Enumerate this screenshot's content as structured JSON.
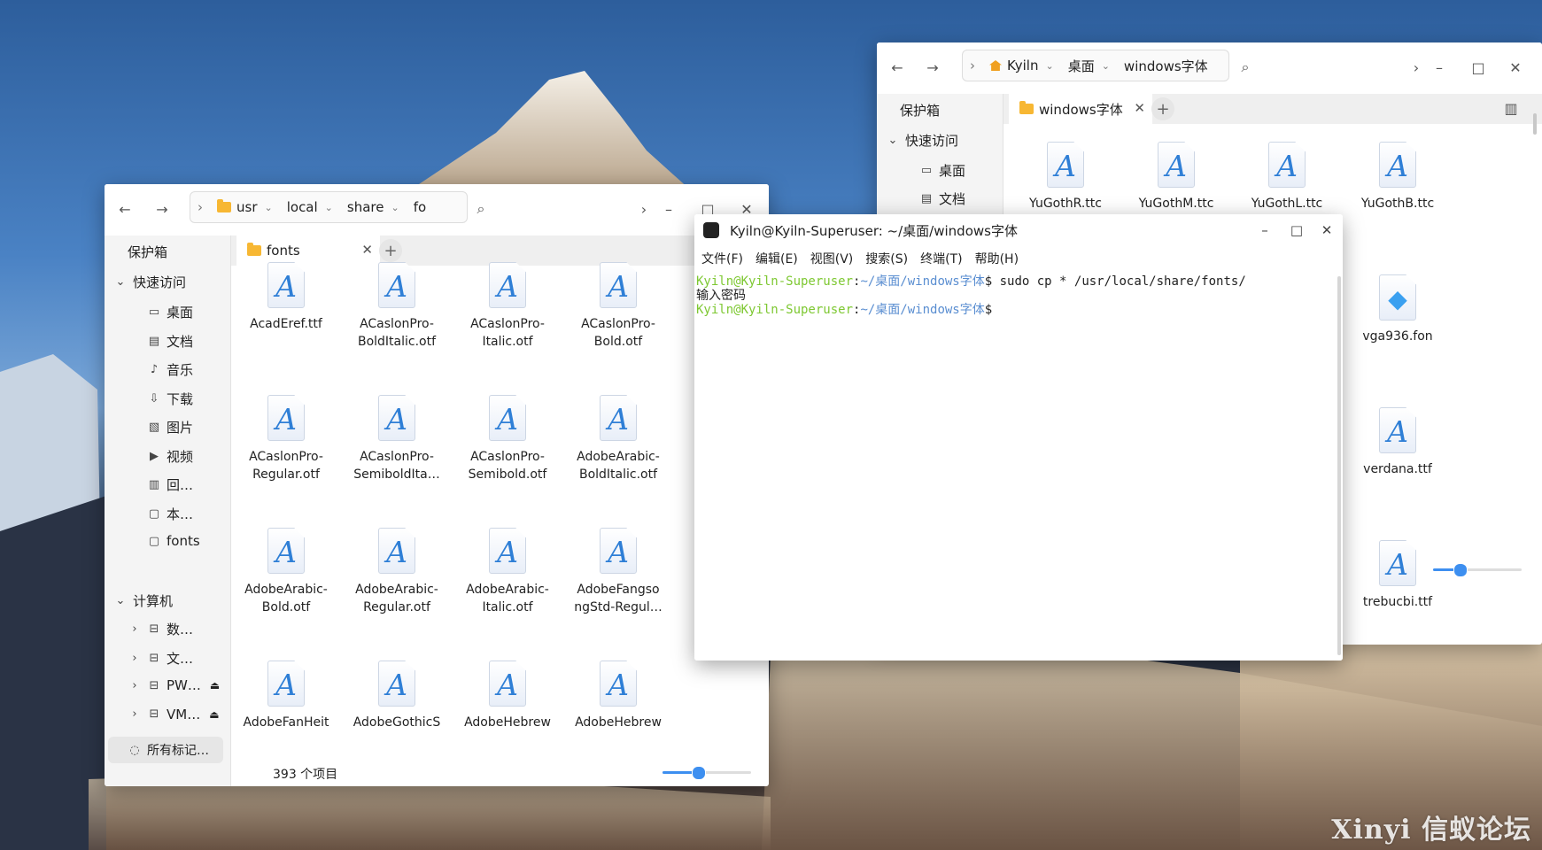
{
  "fm_left": {
    "crumbs": [
      "usr",
      "local",
      "share",
      "fo"
    ],
    "tab_label": "fonts",
    "sidebar": {
      "vault": "保护箱",
      "quick_access": "快速访问",
      "items": [
        {
          "label": "桌面",
          "icon": "desktop-icon",
          "glyph": "▭"
        },
        {
          "label": "文档",
          "icon": "document-icon",
          "glyph": "▤"
        },
        {
          "label": "音乐",
          "icon": "music-icon",
          "glyph": "♪"
        },
        {
          "label": "下载",
          "icon": "download-icon",
          "glyph": "⇩"
        },
        {
          "label": "图片",
          "icon": "image-icon",
          "glyph": "▧"
        },
        {
          "label": "视频",
          "icon": "video-icon",
          "glyph": "▶"
        },
        {
          "label": "回…",
          "icon": "trash-icon",
          "glyph": "▥"
        },
        {
          "label": "本…",
          "icon": "folder-icon",
          "glyph": "▢"
        },
        {
          "label": "fonts",
          "icon": "folder-icon",
          "glyph": "▢"
        }
      ],
      "computer": "计算机",
      "drives": [
        {
          "label": "数…",
          "icon": "drive-icon",
          "eject": false
        },
        {
          "label": "文…",
          "icon": "drive-icon",
          "eject": false
        },
        {
          "label": "PW…",
          "icon": "usb-drive-icon",
          "eject": true
        },
        {
          "label": "VM…",
          "icon": "disc-drive-icon",
          "eject": true
        }
      ],
      "all_tags": "所有标记…"
    },
    "files": [
      [
        "AcadEref.ttf"
      ],
      [
        "ACaslonPro-",
        "BoldItalic.otf"
      ],
      [
        "ACaslonPro-",
        "Italic.otf"
      ],
      [
        "ACaslonPro-",
        "Bold.otf"
      ],
      [
        "ACaslonPro-",
        "Regular.otf"
      ],
      [
        "ACaslonPro-",
        "SemiboldIta…"
      ],
      [
        "ACaslonPro-",
        "Semibold.otf"
      ],
      [
        "AdobeArabic-",
        "BoldItalic.otf"
      ],
      [
        "AdobeArabic-",
        "Bold.otf"
      ],
      [
        "AdobeArabic-",
        "Regular.otf"
      ],
      [
        "AdobeArabic-",
        "Italic.otf"
      ],
      [
        "AdobeFangso",
        "ngStd-Regul…"
      ],
      [
        "AdobeFanHeit"
      ],
      [
        "AdobeGothicS"
      ],
      [
        "AdobeHebrew"
      ],
      [
        "AdobeHebrew"
      ]
    ],
    "status": "393 个项目",
    "zoom_level": 0.4
  },
  "fm_right": {
    "crumbs": [
      "Kyiln",
      "桌面",
      "windows字体"
    ],
    "tab_label": "windows字体",
    "sidebar": {
      "vault": "保护箱",
      "quick_access": "快速访问",
      "items": [
        {
          "label": "桌面",
          "icon": "desktop-icon",
          "glyph": "▭"
        },
        {
          "label": "文档",
          "icon": "document-icon",
          "glyph": "▤"
        }
      ]
    },
    "files": [
      {
        "name": "YuGothR.ttc",
        "type": "font"
      },
      {
        "name": "YuGothM.ttc",
        "type": "font"
      },
      {
        "name": "YuGothL.ttc",
        "type": "font"
      },
      {
        "name": "YuGothB.ttc",
        "type": "font"
      },
      {
        "name": "vga936.fon",
        "type": "fon"
      },
      {
        "name": "verdana.ttf",
        "type": "font"
      },
      {
        "name": "trebucbi.ttf",
        "type": "font"
      }
    ],
    "zoom_level": 0.3
  },
  "terminal": {
    "title": "Kyiln@Kyiln-Superuser: ~/桌面/windows字体",
    "menu": [
      "文件(F)",
      "编辑(E)",
      "视图(V)",
      "搜索(S)",
      "终端(T)",
      "帮助(H)"
    ],
    "lines": [
      {
        "user": "Kyiln@Kyiln-Superuser",
        "path": "~/桌面/windows字体",
        "cmd": "$ sudo cp * /usr/local/share/fonts/"
      },
      {
        "text": "输入密码"
      },
      {
        "user": "Kyiln@Kyiln-Superuser",
        "path": "~/桌面/windows字体",
        "cmd": "$"
      }
    ]
  },
  "watermark": "Xinyi 信蚁论坛",
  "colors": {
    "accent": "#3d8ff0",
    "prompt_user": "#7ec832",
    "prompt_path": "#5a8ed1",
    "folder": "#f7b733"
  }
}
